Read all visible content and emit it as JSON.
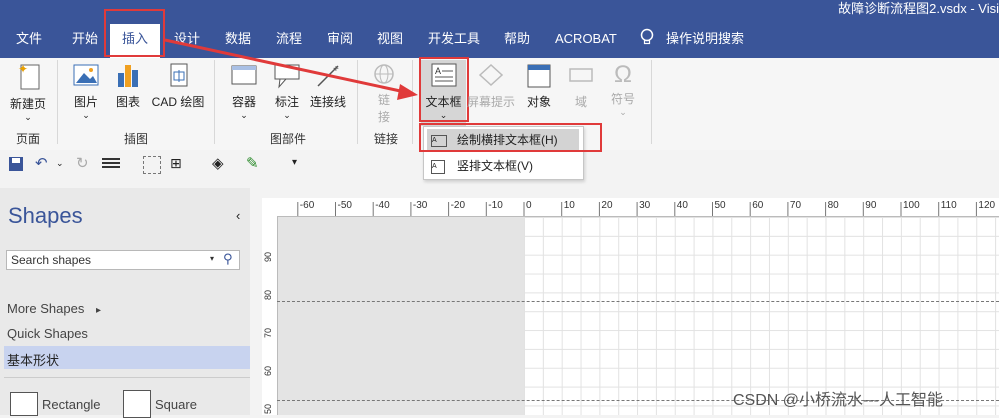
{
  "window": {
    "doc_title": "故障诊断流程图2.vsdx - Visi"
  },
  "tabs": [
    "文件",
    "开始",
    "插入",
    "设计",
    "数据",
    "流程",
    "审阅",
    "视图",
    "开发工具",
    "帮助",
    "ACROBAT"
  ],
  "tell_me": "操作说明搜索",
  "ribbon": {
    "new_page": "新建页",
    "group_page": "页面",
    "picture": "图片",
    "chart": "图表",
    "cad": "CAD 绘图",
    "group_illus": "插图",
    "container": "容器",
    "callout": "标注",
    "connector": "连接线",
    "group_parts": "图部件",
    "link_1": "链",
    "link_2": "接",
    "group_link": "链接",
    "textbox": "文本框",
    "screentip": "屏幕提示",
    "object": "对象",
    "field": "域",
    "symbol": "符号"
  },
  "textbox_menu": {
    "horizontal": "绘制横排文本框(H)",
    "vertical": "竖排文本框(V)"
  },
  "shapes_pane": {
    "title": "Shapes",
    "search_placeholder": "Search shapes",
    "more_shapes": "More Shapes",
    "quick_shapes": "Quick Shapes",
    "basic_shapes": "基本形状",
    "rectangle": "Rectangle",
    "square": "Square"
  },
  "ruler": {
    "h_labels": [
      "-60",
      "-50",
      "-40",
      "-30",
      "-20",
      "-10",
      "0",
      "10",
      "20",
      "30",
      "40",
      "50",
      "60",
      "70",
      "80",
      "90",
      "100",
      "110",
      "120"
    ],
    "v_labels": [
      "90",
      "80",
      "70",
      "60",
      "50"
    ]
  },
  "watermark": "CSDN @小桥流水---人工智能",
  "colors": {
    "accent": "#3a5599",
    "highlight": "#e03a3a"
  }
}
